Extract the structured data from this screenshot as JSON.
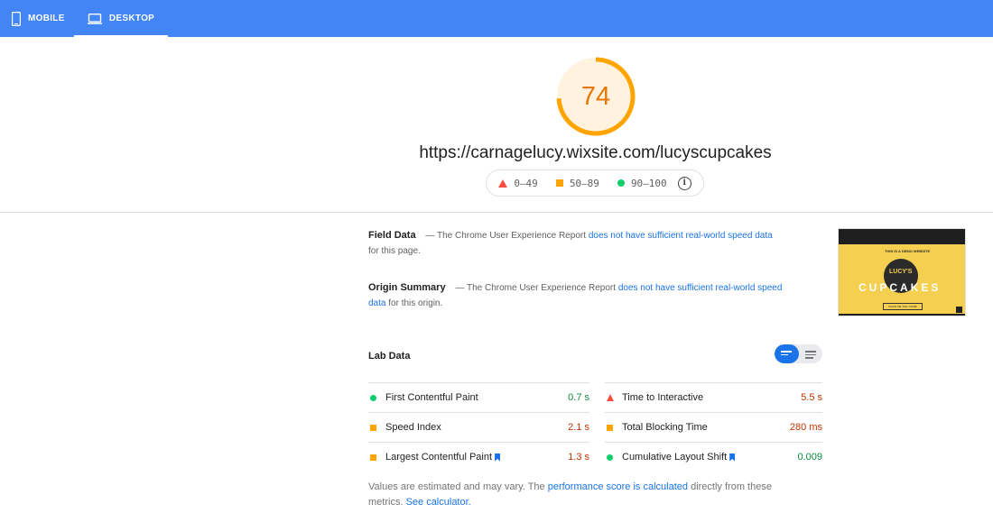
{
  "tabs": {
    "mobile": "MOBILE",
    "desktop": "DESKTOP"
  },
  "score": {
    "value": "74",
    "fraction": 0.74,
    "color": "#ffa400"
  },
  "url": "https://carnagelucy.wixsite.com/lucyscupcakes",
  "legend": {
    "fail": "0–49",
    "average": "50–89",
    "pass": "90–100"
  },
  "field_data": {
    "heading": "Field Data",
    "dash": "—",
    "text_before": "The Chrome User Experience Report",
    "link": "does not have sufficient real-world speed data",
    "text_after": "for this page."
  },
  "origin_summary": {
    "heading": "Origin Summary",
    "dash": "—",
    "text_before": "The Chrome User Experience Report",
    "link": "does not have sufficient real-world speed data",
    "text_after": "for this origin."
  },
  "thumbnail": {
    "banner": "THIS IS A DEMO WEBSITE",
    "logo_text": "LUCY'S",
    "title": "CUPCAKES",
    "button": "SHOW ME THE YUMM!"
  },
  "lab_data": {
    "heading": "Lab Data",
    "metrics": [
      {
        "name": "First Contentful Paint",
        "value": "0.7 s",
        "rating": "pass"
      },
      {
        "name": "Time to Interactive",
        "value": "5.5 s",
        "rating": "fail"
      },
      {
        "name": "Speed Index",
        "value": "2.1 s",
        "rating": "average"
      },
      {
        "name": "Total Blocking Time",
        "value": "280 ms",
        "rating": "average"
      },
      {
        "name": "Largest Contentful Paint",
        "value": "1.3 s",
        "rating": "average"
      },
      {
        "name": "Cumulative Layout Shift",
        "value": "0.009",
        "rating": "pass"
      }
    ]
  },
  "note": {
    "text_before": "Values are estimated and may vary. The",
    "link1": "performance score is calculated",
    "text_middle": "directly from these metrics.",
    "link2": "See calculator."
  },
  "colors": {
    "header": "#4285f4",
    "fail": "#ff4e42",
    "average": "#ffa400",
    "pass": "#0cce6b"
  }
}
